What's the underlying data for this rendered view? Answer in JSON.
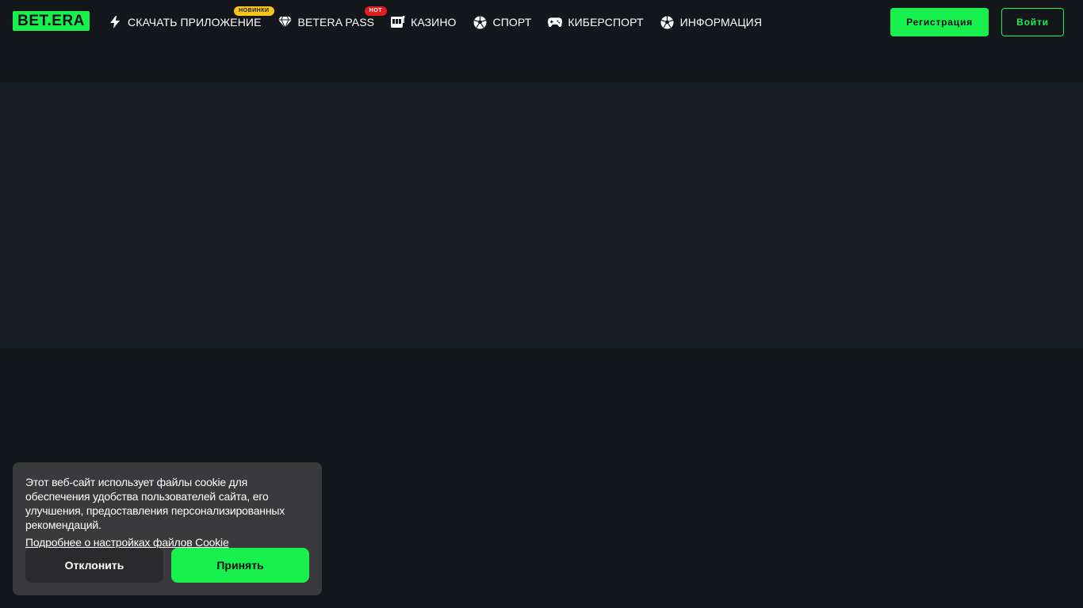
{
  "header": {
    "logo_text": "BET.ERA",
    "nav": [
      {
        "label": "СКАЧАТЬ ПРИЛОЖЕНИЕ",
        "icon": "lightning-icon",
        "badge": "НОВИНКИ"
      },
      {
        "label": "BETERA PASS",
        "icon": "diamond-icon",
        "badge": "HOT"
      },
      {
        "label": "КАЗИНО",
        "icon": "slot-machine-icon"
      },
      {
        "label": "СПОРТ",
        "icon": "soccer-ball-icon"
      },
      {
        "label": "КИБЕРСПОРТ",
        "icon": "gamepad-icon"
      },
      {
        "label": "ИНФОРМАЦИЯ",
        "icon": "soccer-ball-icon"
      }
    ],
    "register_label": "Регистрация",
    "login_label": "Войти"
  },
  "cookie_banner": {
    "text": "Этот веб-сайт использует файлы cookie для обеспечения удобства пользователей сайта, его улучшения, предоставления персонализированных рекомендаций.",
    "link_text": "Подробнее о настройках файлов Cookie",
    "decline_label": "Отклонить",
    "accept_label": "Принять"
  },
  "colors": {
    "accent": "#18f04e",
    "background": "#13171b",
    "banner": "#181e26",
    "cookie_panel": "#3a3a3c",
    "badge_new": "#f5c518",
    "badge_hot": "#e11d1d"
  }
}
